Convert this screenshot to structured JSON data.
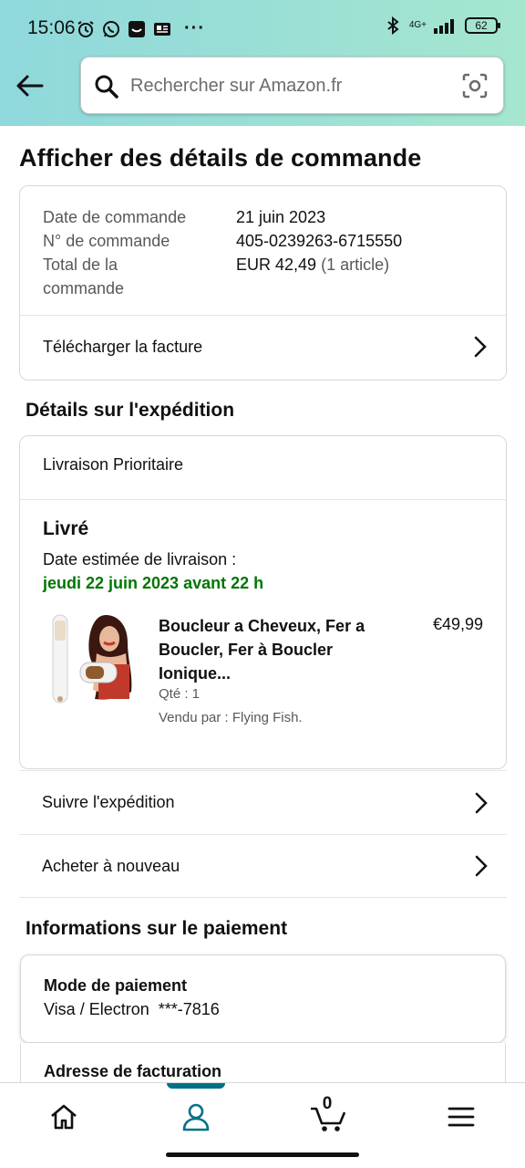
{
  "status_bar": {
    "time": "15:06",
    "network": "4G+",
    "battery": "62"
  },
  "search": {
    "placeholder": "Rechercher sur Amazon.fr"
  },
  "page": {
    "title": "Afficher des détails de commande"
  },
  "order": {
    "date_label": "Date de commande",
    "date_value": "21 juin 2023",
    "number_label": "N° de commande",
    "number_value": "405-0239263-6715550",
    "total_label": "Total de la commande",
    "total_value": "EUR 42,49",
    "total_items": "(1 article)",
    "invoice_link": "Télécharger la facture"
  },
  "shipping": {
    "section_title": "Détails sur l'expédition",
    "method": "Livraison Prioritaire",
    "status": "Livré",
    "estimate_label": "Date estimée de livraison :",
    "estimate_date": "jeudi 22 juin 2023 avant 22 h",
    "product": {
      "title": "Boucleur a Cheveux, Fer a Boucler, Fer à Boucler Ionique...",
      "price": "€49,99",
      "quantity": "Qté : 1",
      "seller": "Vendu par : Flying Fish."
    },
    "track_link": "Suivre l'expédition",
    "buy_again_link": "Acheter à nouveau"
  },
  "payment": {
    "section_title": "Informations sur le paiement",
    "method_label": "Mode de paiement",
    "method_value": "Visa / Electron  ***-7816",
    "billing_label": "Adresse de facturation"
  },
  "bottom_nav": {
    "items": [
      "home-icon",
      "account-icon",
      "cart-icon",
      "menu-icon"
    ],
    "active": "account-icon",
    "cart_count": "0"
  },
  "colors": {
    "header_gradient_start": "#8fd8dc",
    "header_gradient_end": "#a5e6cf",
    "delivered_green": "#007600",
    "active_accent": "#007185"
  }
}
